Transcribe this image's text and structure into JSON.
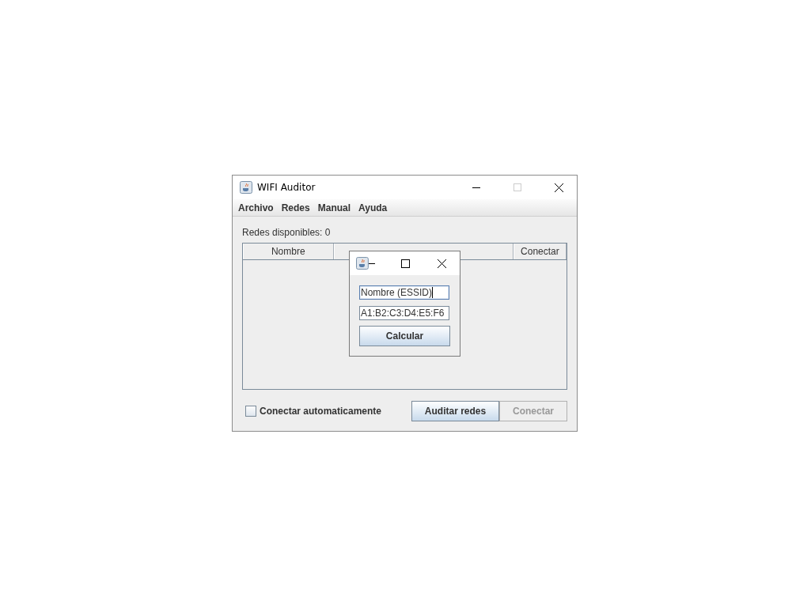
{
  "window": {
    "title": "WIFI Auditor"
  },
  "menu": [
    "Archivo",
    "Redes",
    "Manual",
    "Ayuda"
  ],
  "networks_label": "Redes disponibles: 0",
  "table": {
    "columns": [
      {
        "label": "Nombre"
      },
      {},
      {
        "label": "Conectar"
      }
    ]
  },
  "auto_connect": {
    "label": "Conectar automaticamente",
    "checked": false
  },
  "buttons": [
    {
      "label": "Auditar redes",
      "disabled": false
    },
    {
      "label": "Conectar",
      "disabled": true
    }
  ],
  "dialog": {
    "fields": [
      {
        "value": "Nombre (ESSID)",
        "focused": true
      },
      {
        "value": "A1:B2:C3:D4:E5:F6",
        "focused": false
      }
    ],
    "button": {
      "label": "Calcular",
      "disabled": false
    }
  }
}
